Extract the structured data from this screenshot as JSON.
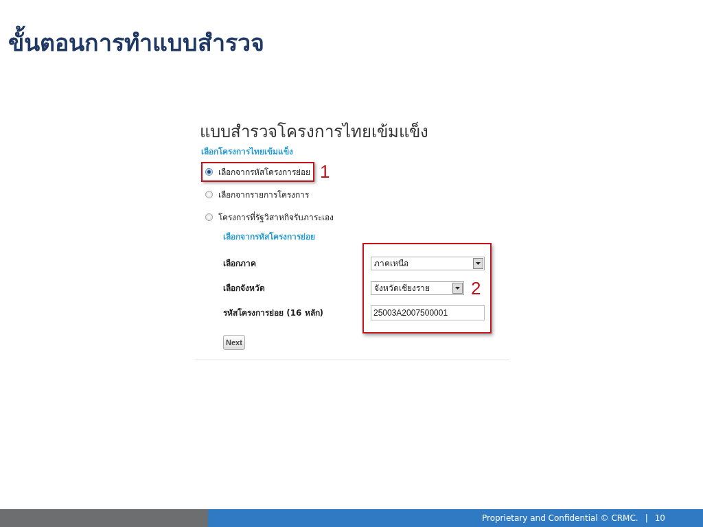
{
  "slide": {
    "title": "ขั้นตอนการทำแบบสำรวจ"
  },
  "form": {
    "heading": "แบบสำรวจโครงการไทยเข้มแข็ง",
    "section_label": "เลือกโครงการไทยเข้มแข็ง",
    "options": [
      {
        "label": "เลือกจากรหัสโครงการย่อย",
        "selected": true
      },
      {
        "label": "เลือกจากรายการโครงการ",
        "selected": false
      },
      {
        "label": "โครงการที่รัฐวิสาหกิจรับภาระเอง",
        "selected": false
      }
    ],
    "sub_heading": "เลือกจากรหัสโครงการย่อย",
    "fields": [
      {
        "kind": "select",
        "label": "เลือกภาค",
        "value": "ภาคเหนือ"
      },
      {
        "kind": "select",
        "label": "เลือกจังหวัด",
        "value": "จังหวัดเชียงราย"
      },
      {
        "kind": "text",
        "label": "รหัสโครงการย่อย (16 หลัก)",
        "value": "25003A2007500001"
      }
    ],
    "button": "Next"
  },
  "annotations": [
    {
      "number": "1"
    },
    {
      "number": "2"
    }
  ],
  "footer": {
    "text": "Proprietary and Confidential © CRMC.",
    "separator": "|",
    "page": "10"
  }
}
